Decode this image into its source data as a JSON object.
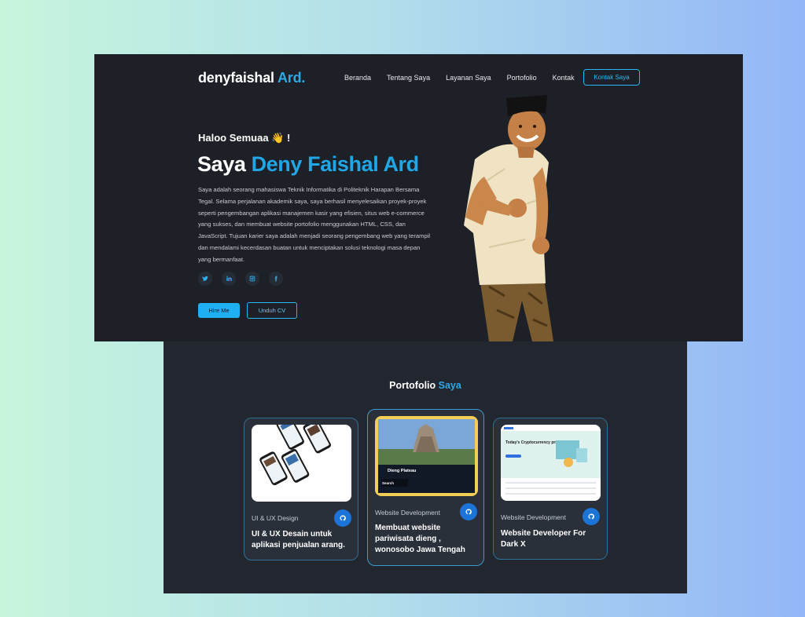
{
  "header": {
    "brand_name": "denyfaishal",
    "brand_accent": "Ard.",
    "nav": [
      "Beranda",
      "Tentang Saya",
      "Layanan Saya",
      "Portofolio",
      "Kontak"
    ],
    "contact_button": "Kontak Saya"
  },
  "hero": {
    "greeting": "Haloo Semuaa 👋 !",
    "headline_prefix": "Saya",
    "headline_name": "Deny Faishal Ard",
    "intro": "Saya adalah seorang mahasiswa Teknik Informatika di Politeknik Harapan Bersama Tegal. Selama perjalanan akademik saya, saya berhasil menyelesaikan proyek-proyek seperti pengembangan aplikasi manajemen kasir yang efisien, situs web e-commerce yang sukses, dan membuat website portofolio menggunakan HTML, CSS, dan JavaScript. Tujuan karier saya adalah menjadi seorang pengembang web yang terampil dan mendalami kecerdasan buatan untuk menciptakan solusi teknologi masa depan yang bermanfaat.",
    "socials": [
      "twitter-icon",
      "linkedin-icon",
      "instagram-icon",
      "facebook-icon"
    ],
    "hire_button": "Hire Me",
    "cv_button": "Unduh CV"
  },
  "portfolio": {
    "title_prefix": "Portofolio",
    "title_accent": "Saya",
    "cards": [
      {
        "category": "UI & UX Design",
        "title": "UI & UX Desain untuk aplikasi penjualan arang."
      },
      {
        "category": "Website Development",
        "title": "Membuat website pariwisata dieng , wonosobo Jawa Tengah",
        "thumb_heading": "Dieng Plateau",
        "thumb_search": "Search"
      },
      {
        "category": "Website Development",
        "title": "Website Developer For Dark X",
        "thumb_heading": "Today's Cryptocurrency prices"
      }
    ]
  },
  "colors": {
    "accent": "#1fa7e8",
    "hero_bg": "#1d2026",
    "portfolio_bg": "#22272f",
    "github_button": "#1b74d6"
  }
}
